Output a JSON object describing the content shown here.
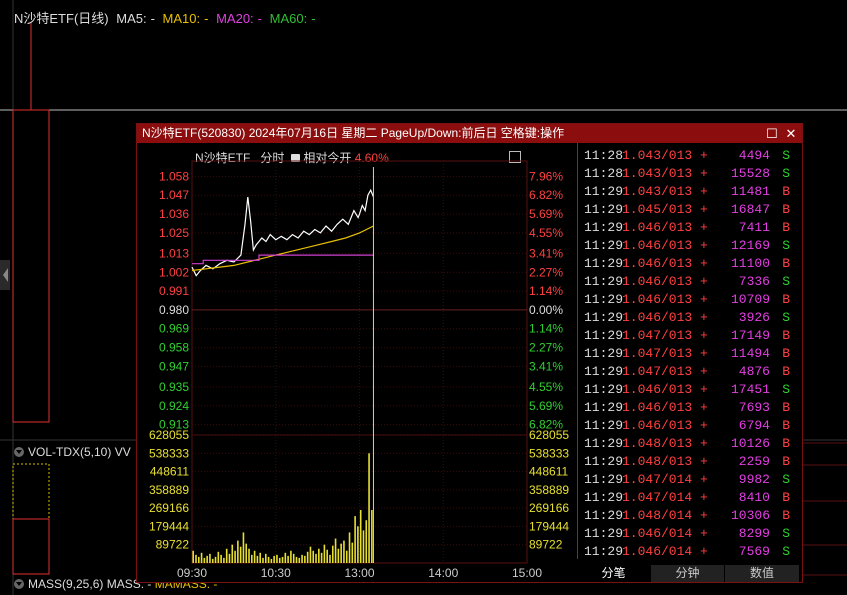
{
  "background": {
    "header": {
      "title": "N沙特ETF(日线)",
      "ma5_label": "MA5:",
      "ma5_value": "-",
      "ma10_label": "MA10:",
      "ma10_value": "-",
      "ma20_label": "MA20:",
      "ma20_value": "-",
      "ma60_label": "MA60:",
      "ma60_value": "-"
    },
    "vol_header": {
      "label": "VOL-TDX(5,10)",
      "extra": "VV"
    },
    "mass_header": {
      "label": "MASS(9,25,6)",
      "mass": "MASS: -",
      "mamass": "MAMASS: -"
    },
    "colors": {
      "ma5": "#dddddd",
      "ma10": "#e8c000",
      "ma20": "#e040e0",
      "ma60": "#30c030"
    }
  },
  "popup": {
    "title": "N沙特ETF(520830) 2024年07月16日 星期二 PageUp/Down:前后日 空格键:操作",
    "chart_header": {
      "name": "N沙特ETF",
      "mode": "分时",
      "relative_label": "相对今开",
      "relative_value": "4.60%"
    },
    "tabs": [
      {
        "label": "分笔",
        "active": true
      },
      {
        "label": "分钟",
        "active": false
      },
      {
        "label": "数值",
        "active": false
      }
    ],
    "ticks": [
      {
        "time": "11:28",
        "price": "1.043/013",
        "arrow": "+",
        "vol": "4494",
        "dir": "S"
      },
      {
        "time": "11:28",
        "price": "1.043/013",
        "arrow": "+",
        "vol": "15528",
        "dir": "S"
      },
      {
        "time": "11:29",
        "price": "1.043/013",
        "arrow": "+",
        "vol": "11481",
        "dir": "B"
      },
      {
        "time": "11:29",
        "price": "1.045/013",
        "arrow": "+",
        "vol": "16847",
        "dir": "B"
      },
      {
        "time": "11:29",
        "price": "1.046/013",
        "arrow": "+",
        "vol": "7411",
        "dir": "B"
      },
      {
        "time": "11:29",
        "price": "1.046/013",
        "arrow": "+",
        "vol": "12169",
        "dir": "S"
      },
      {
        "time": "11:29",
        "price": "1.046/013",
        "arrow": "+",
        "vol": "11100",
        "dir": "B"
      },
      {
        "time": "11:29",
        "price": "1.046/013",
        "arrow": "+",
        "vol": "7336",
        "dir": "S"
      },
      {
        "time": "11:29",
        "price": "1.046/013",
        "arrow": "+",
        "vol": "10709",
        "dir": "B"
      },
      {
        "time": "11:29",
        "price": "1.046/013",
        "arrow": "+",
        "vol": "3926",
        "dir": "S"
      },
      {
        "time": "11:29",
        "price": "1.047/013",
        "arrow": "+",
        "vol": "17149",
        "dir": "B"
      },
      {
        "time": "11:29",
        "price": "1.047/013",
        "arrow": "+",
        "vol": "11494",
        "dir": "B"
      },
      {
        "time": "11:29",
        "price": "1.047/013",
        "arrow": "+",
        "vol": "4876",
        "dir": "B"
      },
      {
        "time": "11:29",
        "price": "1.046/013",
        "arrow": "+",
        "vol": "17451",
        "dir": "S"
      },
      {
        "time": "11:29",
        "price": "1.046/013",
        "arrow": "+",
        "vol": "7693",
        "dir": "B"
      },
      {
        "time": "11:29",
        "price": "1.046/013",
        "arrow": "+",
        "vol": "6794",
        "dir": "B"
      },
      {
        "time": "11:29",
        "price": "1.048/013",
        "arrow": "+",
        "vol": "10126",
        "dir": "B"
      },
      {
        "time": "11:29",
        "price": "1.048/013",
        "arrow": "+",
        "vol": "2259",
        "dir": "B"
      },
      {
        "time": "11:29",
        "price": "1.047/014",
        "arrow": "+",
        "vol": "9982",
        "dir": "S"
      },
      {
        "time": "11:29",
        "price": "1.047/014",
        "arrow": "+",
        "vol": "8410",
        "dir": "B"
      },
      {
        "time": "11:29",
        "price": "1.048/014",
        "arrow": "+",
        "vol": "10306",
        "dir": "B"
      },
      {
        "time": "11:29",
        "price": "1.046/014",
        "arrow": "+",
        "vol": "8299",
        "dir": "S"
      },
      {
        "time": "11:29",
        "price": "1.046/014",
        "arrow": "+",
        "vol": "7569",
        "dir": "S"
      }
    ],
    "colors": {
      "up": "#ff4040",
      "down": "#30d030",
      "flat": "#dddddd",
      "vol_bar": "#e8e030",
      "price_line": "#ffffff",
      "avg_line": "#e8c000",
      "open_line": "#d040d0"
    }
  },
  "chart_data": {
    "type": "line",
    "title": "N沙特ETF 分时",
    "prev_close": 0.98,
    "price_axis": {
      "ticks": [
        "1.058",
        "1.047",
        "1.036",
        "1.025",
        "1.013",
        "1.002",
        "0.991",
        "0.980",
        "0.969",
        "0.958",
        "0.947",
        "0.935",
        "0.924",
        "0.913"
      ],
      "pct_ticks": [
        "7.96%",
        "6.82%",
        "5.69%",
        "4.55%",
        "3.41%",
        "2.27%",
        "1.14%",
        "0.00%",
        "1.14%",
        "2.27%",
        "3.41%",
        "4.55%",
        "5.69%",
        "6.82%"
      ],
      "ylim": [
        0.9075,
        1.0635
      ]
    },
    "volume_axis": {
      "ticks": [
        "628055",
        "538333",
        "448611",
        "358889",
        "269166",
        "179444",
        "89722"
      ],
      "ylim": [
        0,
        628055
      ]
    },
    "x_ticks": [
      "09:30",
      "10:30",
      "13:00",
      "14:00",
      "15:00"
    ],
    "x_range_minutes": [
      0,
      240
    ],
    "series": [
      {
        "name": "price",
        "x": [
          0,
          3,
          6,
          10,
          15,
          20,
          25,
          30,
          35,
          38,
          40,
          42,
          44,
          46,
          48,
          50,
          53,
          56,
          60,
          64,
          68,
          72,
          76,
          80,
          84,
          88,
          92,
          96,
          100,
          104,
          108,
          112,
          116,
          119,
          120,
          122,
          124,
          126,
          128,
          130
        ],
        "values": [
          1.005,
          1.0,
          1.003,
          1.006,
          1.004,
          1.007,
          1.009,
          1.008,
          1.012,
          1.03,
          1.046,
          1.032,
          1.015,
          1.018,
          1.02,
          1.022,
          1.02,
          1.024,
          1.021,
          1.023,
          1.021,
          1.024,
          1.022,
          1.026,
          1.024,
          1.027,
          1.025,
          1.029,
          1.026,
          1.03,
          1.033,
          1.03,
          1.038,
          1.034,
          1.036,
          1.041,
          1.038,
          1.047,
          1.05,
          1.046
        ]
      },
      {
        "name": "avg",
        "x": [
          0,
          10,
          20,
          30,
          40,
          50,
          60,
          70,
          80,
          90,
          100,
          110,
          120,
          130
        ],
        "values": [
          1.003,
          1.004,
          1.005,
          1.006,
          1.008,
          1.01,
          1.012,
          1.014,
          1.016,
          1.018,
          1.02,
          1.022,
          1.025,
          1.029
        ]
      },
      {
        "name": "open",
        "x": [
          0,
          8,
          8,
          48,
          48,
          130
        ],
        "values": [
          1.007,
          1.007,
          1.009,
          1.009,
          1.012,
          1.012
        ]
      }
    ],
    "volume": {
      "x": [
        1,
        3,
        5,
        7,
        9,
        11,
        13,
        15,
        17,
        19,
        21,
        23,
        25,
        27,
        29,
        31,
        33,
        35,
        37,
        39,
        41,
        43,
        45,
        47,
        49,
        51,
        53,
        55,
        57,
        59,
        61,
        63,
        65,
        67,
        69,
        71,
        73,
        75,
        77,
        79,
        81,
        83,
        85,
        87,
        89,
        91,
        93,
        95,
        97,
        99,
        101,
        103,
        105,
        107,
        109,
        111,
        113,
        115,
        117,
        119,
        121,
        123,
        125,
        127,
        129
      ],
      "values": [
        60000,
        40000,
        30000,
        50000,
        25000,
        35000,
        45000,
        20000,
        30000,
        55000,
        40000,
        25000,
        70000,
        45000,
        90000,
        60000,
        110000,
        80000,
        150000,
        95000,
        70000,
        40000,
        60000,
        35000,
        50000,
        25000,
        45000,
        30000,
        20000,
        35000,
        40000,
        25000,
        30000,
        50000,
        35000,
        60000,
        45000,
        30000,
        25000,
        40000,
        35000,
        55000,
        80000,
        60000,
        45000,
        70000,
        50000,
        90000,
        65000,
        40000,
        85000,
        120000,
        70000,
        95000,
        110000,
        60000,
        150000,
        100000,
        230000,
        180000,
        260000,
        160000,
        210000,
        538333,
        260000
      ]
    }
  }
}
